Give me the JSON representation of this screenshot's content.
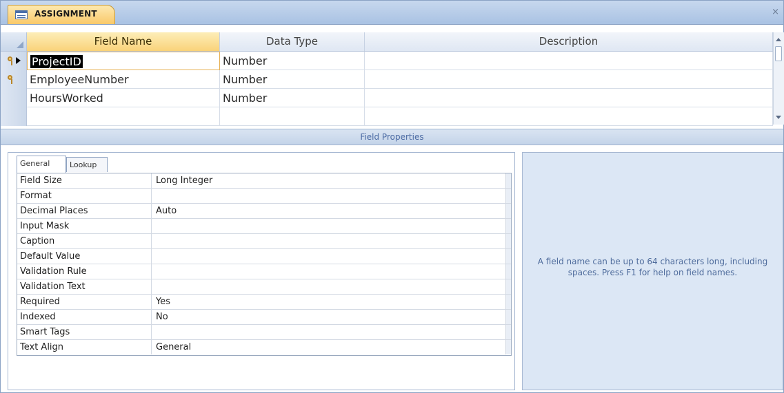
{
  "document_tab": {
    "title": "ASSIGNMENT",
    "icon": "table-icon"
  },
  "window_controls": {
    "close_label": "×"
  },
  "grid": {
    "headers": {
      "field_name": "Field Name",
      "data_type": "Data Type",
      "description": "Description"
    },
    "rows": [
      {
        "field_name": "ProjectID",
        "data_type": "Number",
        "description": "",
        "primary_key": true,
        "current": true
      },
      {
        "field_name": "EmployeeNumber",
        "data_type": "Number",
        "description": "",
        "primary_key": true,
        "current": false
      },
      {
        "field_name": "HoursWorked",
        "data_type": "Number",
        "description": "",
        "primary_key": false,
        "current": false
      },
      {
        "field_name": "",
        "data_type": "",
        "description": "",
        "primary_key": false,
        "current": false
      }
    ]
  },
  "field_properties": {
    "title": "Field Properties",
    "tabs": {
      "general": "General",
      "lookup": "Lookup"
    },
    "properties": [
      {
        "label": "Field Size",
        "value": "Long Integer"
      },
      {
        "label": "Format",
        "value": ""
      },
      {
        "label": "Decimal Places",
        "value": "Auto"
      },
      {
        "label": "Input Mask",
        "value": ""
      },
      {
        "label": "Caption",
        "value": ""
      },
      {
        "label": "Default Value",
        "value": ""
      },
      {
        "label": "Validation Rule",
        "value": ""
      },
      {
        "label": "Validation Text",
        "value": ""
      },
      {
        "label": "Required",
        "value": "Yes"
      },
      {
        "label": "Indexed",
        "value": "No"
      },
      {
        "label": "Smart Tags",
        "value": ""
      },
      {
        "label": "Text Align",
        "value": "General"
      }
    ]
  },
  "help_text": "A field name can be up to 64 characters long, including spaces. Press F1 for help on field names.",
  "colors": {
    "tab_active": "#f9c96a",
    "header_selected": "#f9d37a",
    "help_background": "#dce7f5",
    "help_text": "#4f6c9c",
    "frame_border": "#8aa2c4"
  }
}
